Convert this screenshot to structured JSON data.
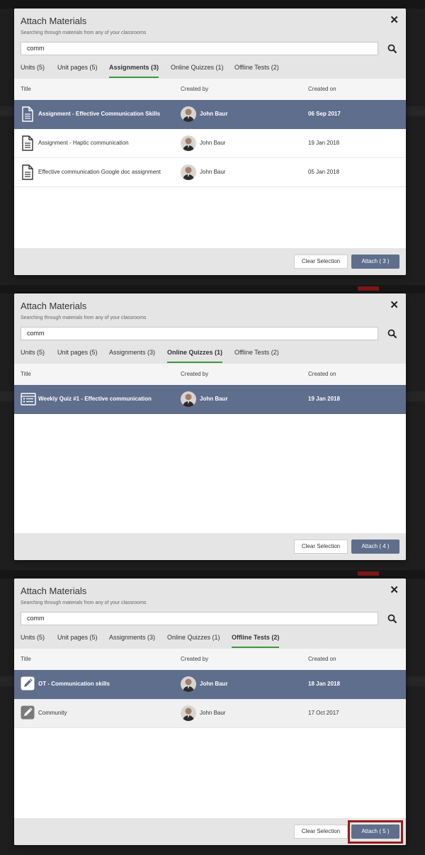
{
  "colors": {
    "accent": "#5f6e8c",
    "tab_underline": "#3c9a3c",
    "highlight": "#9b1b1b",
    "header_bg": "#e5e5e5"
  },
  "panels": [
    {
      "title": "Attach Materials",
      "close_icon": "close-icon",
      "subtitle": "Searching through materials from any of your classrooms",
      "search_value": "comm",
      "search_icon": "search-icon",
      "tabs": [
        {
          "label": "Units (5)",
          "active": false
        },
        {
          "label": "Unit pages (5)",
          "active": false
        },
        {
          "label": "Assignments (3)",
          "active": true
        },
        {
          "label": "Online Quizzes (1)",
          "active": false
        },
        {
          "label": "Offline Tests (2)",
          "active": false
        }
      ],
      "columns": [
        "Title",
        "Created by",
        "Created on"
      ],
      "rows": [
        {
          "icon": "document-icon",
          "title": "Assignment - Effective Communication Skills",
          "creator": "John Baur",
          "date": "06 Sep 2017",
          "selected": true
        },
        {
          "icon": "document-icon",
          "title": "Assignment - Haptic communication",
          "creator": "John Baur",
          "date": "19 Jan 2018",
          "selected": false
        },
        {
          "icon": "document-icon",
          "title": "Effective communication Google doc assignment",
          "creator": "John Baur",
          "date": "05 Jan 2018",
          "selected": false
        }
      ],
      "clear_label": "Clear Selection",
      "attach_label": "Attach ( 3 )"
    },
    {
      "title": "Attach Materials",
      "close_icon": "close-icon",
      "subtitle": "Searching through materials from any of your classrooms",
      "search_value": "comm",
      "search_icon": "search-icon",
      "tabs": [
        {
          "label": "Units (5)",
          "active": false
        },
        {
          "label": "Unit pages (5)",
          "active": false
        },
        {
          "label": "Assignments (3)",
          "active": false
        },
        {
          "label": "Online Quizzes (1)",
          "active": true
        },
        {
          "label": "Offline Tests (2)",
          "active": false
        }
      ],
      "columns": [
        "Title",
        "Created by",
        "Created on"
      ],
      "rows": [
        {
          "icon": "quiz-list-icon",
          "title": "Weekly Quiz #1 - Effective communication",
          "creator": "John Baur",
          "date": "19 Jan 2018",
          "selected": true
        }
      ],
      "clear_label": "Clear Selection",
      "attach_label": "Attach ( 4 )"
    },
    {
      "title": "Attach Materials",
      "close_icon": "close-icon",
      "subtitle": "Searching through materials from any of your classrooms",
      "search_value": "comm",
      "search_icon": "search-icon",
      "tabs": [
        {
          "label": "Units (5)",
          "active": false
        },
        {
          "label": "Unit pages (5)",
          "active": false
        },
        {
          "label": "Assignments (3)",
          "active": false
        },
        {
          "label": "Online Quizzes (1)",
          "active": false
        },
        {
          "label": "Offline Tests (2)",
          "active": true
        }
      ],
      "columns": [
        "Title",
        "Created by",
        "Created on"
      ],
      "rows": [
        {
          "icon": "pencil-icon",
          "title": "OT - Communication skills",
          "creator": "John Baur",
          "date": "18 Jan 2018",
          "selected": true
        },
        {
          "icon": "pencil-icon",
          "title": "Community",
          "creator": "John Baur",
          "date": "17 Oct 2017",
          "selected": false
        }
      ],
      "clear_label": "Clear Selection",
      "attach_label": "Attach ( 5 )",
      "attach_highlighted": true
    }
  ]
}
